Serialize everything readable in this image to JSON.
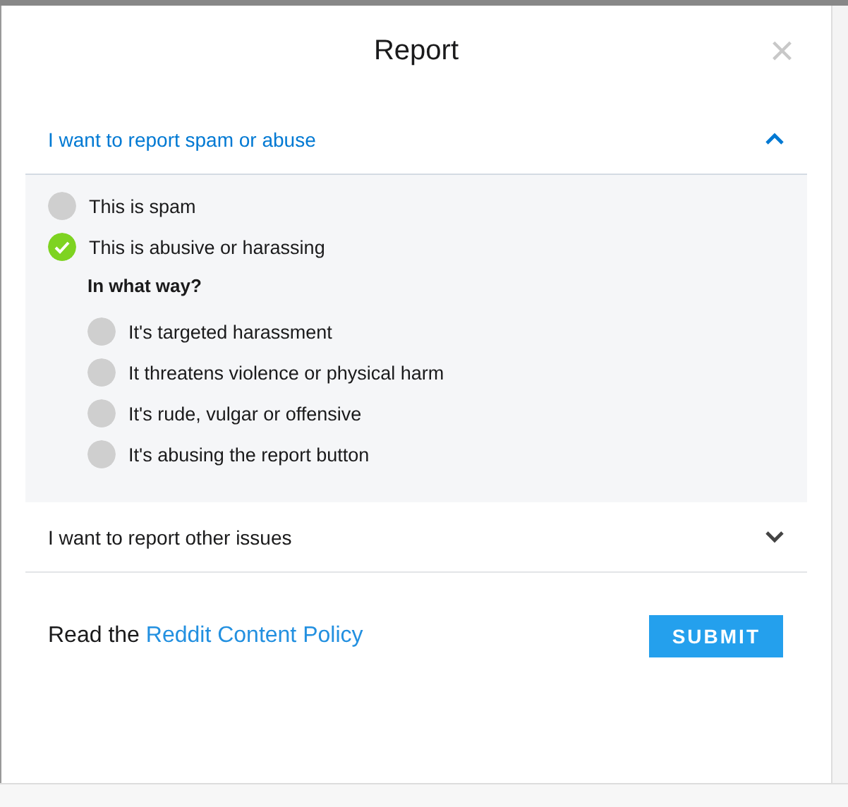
{
  "dialog": {
    "title": "Report",
    "close": "×"
  },
  "sections": [
    {
      "title": "I want to report spam or abuse",
      "expanded": true,
      "options": [
        {
          "label": "This is spam",
          "checked": false
        },
        {
          "label": "This is abusive or harassing",
          "checked": true
        }
      ],
      "question": "In what way?",
      "sub_options": [
        {
          "label": "It's targeted harassment",
          "checked": false
        },
        {
          "label": "It threatens violence or physical harm",
          "checked": false
        },
        {
          "label": "It's rude, vulgar or offensive",
          "checked": false
        },
        {
          "label": "It's abusing the report button",
          "checked": false
        }
      ]
    },
    {
      "title": "I want to report other issues",
      "expanded": false
    }
  ],
  "footer": {
    "text": "Read the",
    "link": "Reddit Content Policy",
    "button": "SUBMIT"
  }
}
